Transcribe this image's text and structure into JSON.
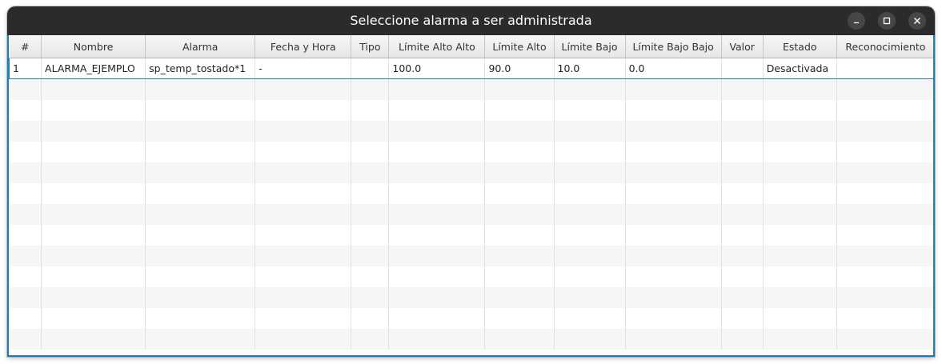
{
  "window": {
    "title": "Seleccione alarma a ser administrada"
  },
  "table": {
    "columns": [
      "#",
      "Nombre",
      "Alarma",
      "Fecha y Hora",
      "Tipo",
      "Límite Alto Alto",
      "Límite Alto",
      "Límite Bajo",
      "Límite Bajo Bajo",
      "Valor",
      "Estado",
      "Reconocimiento"
    ],
    "rows": [
      [
        "1",
        "ALARMA_EJEMPLO",
        "sp_temp_tostado*1",
        "-",
        "",
        "100.0",
        "90.0",
        "10.0",
        "0.0",
        "",
        "Desactivada",
        ""
      ]
    ]
  }
}
